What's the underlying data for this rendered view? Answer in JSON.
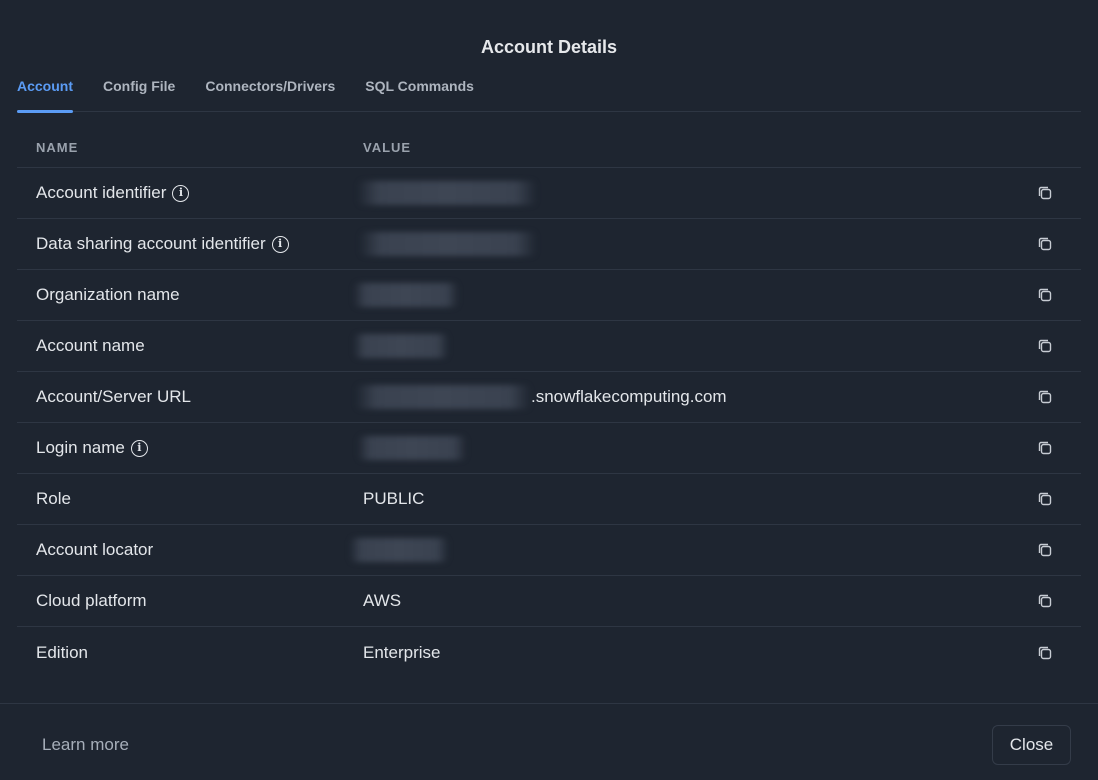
{
  "dialog": {
    "title": "Account Details"
  },
  "tabs": [
    {
      "label": "Account"
    },
    {
      "label": "Config File"
    },
    {
      "label": "Connectors/Drivers"
    },
    {
      "label": "SQL Commands"
    }
  ],
  "table": {
    "headers": {
      "name": "NAME",
      "value": "VALUE"
    },
    "rows": [
      {
        "name": "Account identifier",
        "value": "",
        "info": true,
        "redacted": true
      },
      {
        "name": "Data sharing account identifier",
        "value": "",
        "info": true,
        "redacted": true
      },
      {
        "name": "Organization name",
        "value": "",
        "redacted": true
      },
      {
        "name": "Account name",
        "value": "",
        "redacted": true
      },
      {
        "name": "Account/Server URL",
        "value": ".snowflakecomputing.com",
        "redacted": true
      },
      {
        "name": "Login name",
        "value": "",
        "info": true,
        "redacted": true
      },
      {
        "name": "Role",
        "value": "PUBLIC"
      },
      {
        "name": "Account locator",
        "value": "",
        "redacted": true
      },
      {
        "name": "Cloud platform",
        "value": "AWS"
      },
      {
        "name": "Edition",
        "value": "Enterprise"
      }
    ]
  },
  "footer": {
    "learn_more": "Learn more",
    "close_label": "Close"
  },
  "icons": {
    "info": "info-icon",
    "copy": "copy-icon"
  },
  "colors": {
    "accent": "#5b9cf5",
    "background": "#1e2530"
  }
}
